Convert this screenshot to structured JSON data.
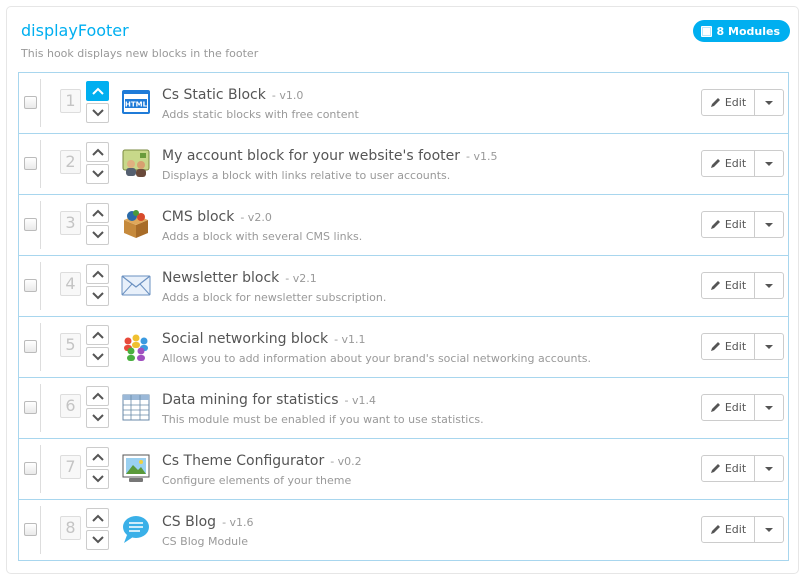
{
  "hook": {
    "title": "displayFooter",
    "description": "This hook displays new blocks in the footer",
    "badge_label": "8 Modules"
  },
  "colors": {
    "accent": "#00aff0",
    "row_border": "#a8d6ee"
  },
  "edit_label": "Edit",
  "modules": [
    {
      "position": "1",
      "name": "Cs Static Block",
      "version": "- v1.0",
      "description": "Adds static blocks with free content",
      "icon": "html-block-icon"
    },
    {
      "position": "2",
      "name": "My account block for your website's footer",
      "version": "- v1.5",
      "description": "Displays a block with links relative to user accounts.",
      "icon": "user-account-icon"
    },
    {
      "position": "3",
      "name": "CMS block",
      "version": "- v2.0",
      "description": "Adds a block with several CMS links.",
      "icon": "cms-box-icon"
    },
    {
      "position": "4",
      "name": "Newsletter block",
      "version": "- v2.1",
      "description": "Adds a block for newsletter subscription.",
      "icon": "envelope-icon"
    },
    {
      "position": "5",
      "name": "Social networking block",
      "version": "- v1.1",
      "description": "Allows you to add information about your brand's social networking accounts.",
      "icon": "social-people-icon"
    },
    {
      "position": "6",
      "name": "Data mining for statistics",
      "version": "- v1.4",
      "description": "This module must be enabled if you want to use statistics.",
      "icon": "spreadsheet-icon"
    },
    {
      "position": "7",
      "name": "Cs Theme Configurator",
      "version": "- v0.2",
      "description": "Configure elements of your theme",
      "icon": "theme-picture-icon"
    },
    {
      "position": "8",
      "name": "CS Blog",
      "version": "- v1.6",
      "description": "CS Blog Module",
      "icon": "speech-bubble-icon"
    }
  ]
}
